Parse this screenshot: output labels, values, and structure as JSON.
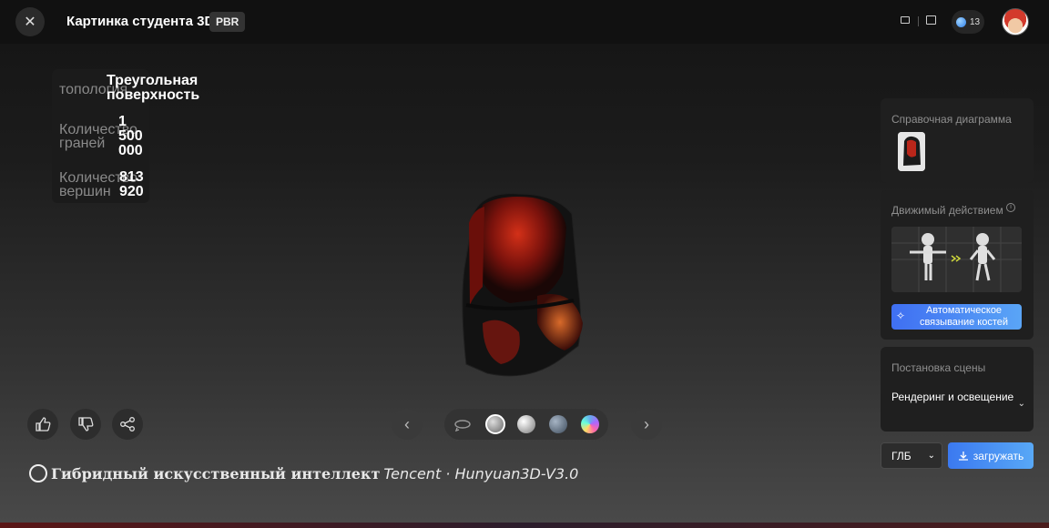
{
  "header": {
    "close_icon": "close-icon",
    "title": "Картинка студента 3D",
    "badge": "PBR",
    "credits": "13"
  },
  "model_info": {
    "topology_label": "топология",
    "topology_value": "Треугольная поверхность",
    "faces_label": "Количество граней",
    "faces_value": "1 500 000",
    "vertices_label": "Количество вершин",
    "vertices_value": "813 920"
  },
  "watermark": {
    "text": "Гибридный искусственный интеллект",
    "brand": "Tencent · Hunyuan3D-V3.0"
  },
  "right_panel": {
    "reference_title": "Справочная диаграмма",
    "animation_title": "Движимый действием",
    "auto_rig_label": "Автоматическое связывание костей",
    "scene_title": "Постановка сцены",
    "scene_value": "Рендеринг и освещение"
  },
  "actions": {
    "format": "ГЛБ",
    "download": "загружать"
  },
  "colors": {
    "accent": "#4a8cf5",
    "model_red": "#c0281a"
  }
}
